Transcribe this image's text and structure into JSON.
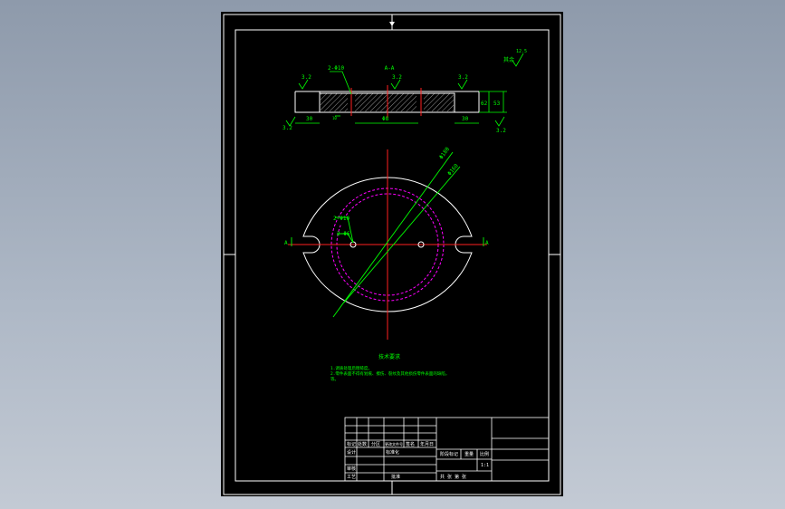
{
  "colors": {
    "background": "#000000",
    "outer_frame": "#ffffff",
    "section": "#ffffff",
    "dimension": "#00ff00",
    "centerline": "#ff2020",
    "hidden_circle": "#ff00ff",
    "viewport_bg": "#9aa5b5"
  },
  "section_view": {
    "title": "A-A",
    "roughness_top_left": "3.2",
    "roughness_top_center": "3.2",
    "roughness_top_right": "3.2",
    "roughness_bottom_left": "3.2",
    "roughness_bottom_right": "3.2",
    "hole_callout": "2-Φ10",
    "dim_left": "30",
    "dim_center": "Φ8",
    "dim_right": "30",
    "dim_height_inner": "62",
    "dim_height_outer": "53",
    "dim_small": "10"
  },
  "roughness_note": {
    "label": "其余",
    "value": "12.5"
  },
  "plan_view": {
    "dia_outer": "Φ180",
    "dia_inner": "Φ160",
    "hole_callout_1": "2-Φ10",
    "hole_callout_2": "2-Φ6",
    "section_mark_left": "A",
    "section_mark_right": "A"
  },
  "tech_requirements": {
    "title": "技术要求",
    "line1": "1.调质处理后粗糙度。",
    "line2": "2.零件表面不得有划痕、擦伤、裂纹及其他损伤零件表面的缺陷，",
    "line3": "等。"
  },
  "title_block": {
    "row_labels": [
      "标记",
      "处数",
      "分区",
      "更改文件号",
      "签名",
      "年月日"
    ],
    "design": "设计",
    "standardize": "标准化",
    "review": "审核",
    "process": "工艺",
    "approve": "批准",
    "stage_label": "阶段标记",
    "weight_label": "重量",
    "scale_label": "比例",
    "scale_value": "1:1",
    "sheet_info": "共  张  第  张"
  }
}
